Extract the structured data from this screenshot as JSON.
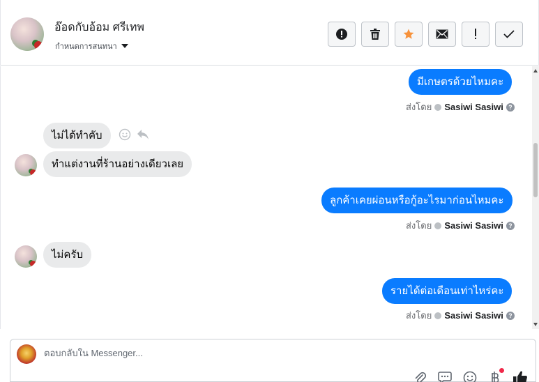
{
  "header": {
    "contact_name": "อ๊อดกับอ้อม ศรีเทพ",
    "conversation_settings": "กำหนดการสนทนา",
    "actions": [
      {
        "name": "mark-spam",
        "icon": "alert-circle-icon"
      },
      {
        "name": "delete",
        "icon": "trash-icon"
      },
      {
        "name": "star",
        "icon": "star-icon"
      },
      {
        "name": "mark-unread",
        "icon": "envelope-icon"
      },
      {
        "name": "important",
        "icon": "exclamation-icon"
      },
      {
        "name": "done",
        "icon": "check-icon"
      }
    ],
    "star_color": "#f7923b"
  },
  "messages": [
    {
      "direction": "outgoing",
      "text": "มีเกษตรด้วยไหมคะ",
      "sent_by_label": "ส่งโดย",
      "sender": "Sasiwi Sasiwi"
    },
    {
      "direction": "incoming",
      "text": "ไม่ได้ทำคับ"
    },
    {
      "direction": "incoming",
      "text": "ทำแต่งานที่ร้านอย่างเดียวเลย"
    },
    {
      "direction": "outgoing",
      "text": "ลูกค้าเคยผ่อนหรือกู้อะไรมาก่อนไหมคะ",
      "sent_by_label": "ส่งโดย",
      "sender": "Sasiwi Sasiwi"
    },
    {
      "direction": "incoming",
      "text": "ไม่ครับ"
    },
    {
      "direction": "outgoing",
      "text": "รายได้ต่อเดือนเท่าไหร่คะ",
      "sent_by_label": "ส่งโดย",
      "sender": "Sasiwi Sasiwi"
    }
  ],
  "composer": {
    "placeholder": "ตอบกลับใน Messenger...",
    "tools": [
      "paperclip-icon",
      "saved-reply-icon",
      "emoji-icon",
      "baht-icon",
      "like-icon"
    ]
  },
  "colors": {
    "outgoing_bubble": "#0a7cff",
    "incoming_bubble": "#e9eaeb",
    "notification_dot": "#f02849"
  }
}
